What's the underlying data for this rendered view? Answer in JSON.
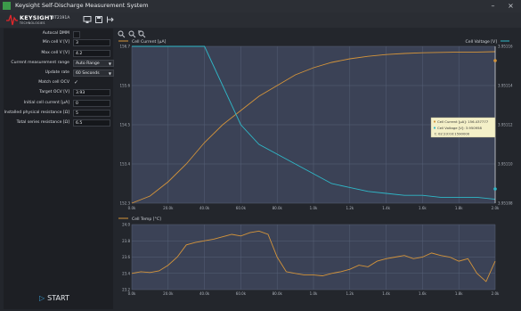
{
  "window": {
    "title": "Keysight Self-Discharge Measurement System"
  },
  "header": {
    "brand": "KEYSIGHT",
    "brand_sub": "TECHNOLOGIES",
    "model": "BT2191A"
  },
  "toolbar": {
    "icons": [
      "monitor-icon",
      "save-icon",
      "export-icon"
    ]
  },
  "settings": {
    "autocal_label": "Autocal DMM",
    "min_v_label": "Min cell V [V]",
    "min_v_value": "3",
    "max_v_label": "Max cell V [V]",
    "max_v_value": "4.2",
    "range_label": "Current measurement range",
    "range_value": "Auto Range",
    "update_label": "Update rate",
    "update_value": "60 Seconds",
    "match_label": "Match cell OCV",
    "target_label": "Target OCV [V]",
    "target_value": "3.93",
    "initial_label": "Initial cell current [µA]",
    "initial_value": "0",
    "phys_label": "Installed physical resistance [Ω]",
    "phys_value": "5",
    "series_label": "Total series resistance [Ω]",
    "series_value": "6.5"
  },
  "start_label": "START",
  "colors": {
    "current": "#d4943a",
    "voltage": "#2fb8c8",
    "temp": "#d4943a",
    "plot_bg": "#3b4256"
  },
  "tooltip": {
    "line1": "Cell Current [µA]: 156.437777",
    "line2": "Cell Voltage [V]: 3.950958",
    "line3": "t: 02:23:03:1590000"
  },
  "chart_data": [
    {
      "type": "line",
      "title": "",
      "series": [
        {
          "name": "Cell Current [µA]",
          "axis": "left",
          "x": [
            0,
            0.1,
            0.2,
            0.3,
            0.4,
            0.5,
            0.6,
            0.7,
            0.8,
            0.9,
            1.0,
            1.1,
            1.2,
            1.3,
            1.4,
            1.5,
            1.6,
            1.7,
            1.8,
            1.9,
            2.0
          ],
          "values": [
            152.3,
            152.5,
            152.9,
            153.4,
            154.0,
            154.5,
            154.9,
            155.3,
            155.6,
            155.9,
            156.1,
            156.25,
            156.35,
            156.42,
            156.47,
            156.5,
            156.52,
            156.53,
            156.54,
            156.54,
            156.55
          ]
        },
        {
          "name": "Cell Voltage [V]",
          "axis": "right",
          "x": [
            0,
            0.1,
            0.2,
            0.3,
            0.4,
            0.5,
            0.6,
            0.7,
            0.8,
            0.9,
            1.0,
            1.1,
            1.2,
            1.3,
            1.4,
            1.5,
            1.6,
            1.7,
            1.8,
            1.9,
            2.0
          ],
          "values": [
            3.9514,
            3.9513,
            3.95125,
            3.9512,
            3.95117,
            3.95114,
            3.95112,
            3.95111,
            3.951105,
            3.9511,
            3.951095,
            3.95109,
            3.951088,
            3.951086,
            3.951085,
            3.951084,
            3.951084,
            3.951083,
            3.951083,
            3.951083,
            3.951082
          ]
        }
      ],
      "xticks": [
        "0.0k",
        "20.0k",
        "40.0k",
        "60.0k",
        "80.0k",
        "1.0k",
        "1.2k",
        "1.4k",
        "1.6k",
        "1.8k",
        "2.0k"
      ],
      "yticks_left": [
        "152.3",
        "153.4",
        "154.5",
        "155.6",
        "156.7"
      ],
      "yticks_right": [
        "3.95108",
        "3.95110",
        "3.95112",
        "3.95114",
        "3.95116"
      ],
      "ylim_left": [
        152.3,
        156.7
      ],
      "ylim_right": [
        3.95108,
        3.95116
      ],
      "legend_left": "Cell Current [µA]",
      "legend_right": "Cell Voltage [V]"
    },
    {
      "type": "line",
      "title": "",
      "series": [
        {
          "name": "Cell Temp [°C]",
          "x": [
            0,
            0.05,
            0.1,
            0.15,
            0.2,
            0.25,
            0.3,
            0.35,
            0.4,
            0.45,
            0.5,
            0.55,
            0.6,
            0.65,
            0.7,
            0.75,
            0.8,
            0.85,
            0.9,
            0.95,
            1.0,
            1.05,
            1.1,
            1.15,
            1.2,
            1.25,
            1.3,
            1.35,
            1.4,
            1.45,
            1.5,
            1.55,
            1.6,
            1.65,
            1.7,
            1.75,
            1.8,
            1.85,
            1.9,
            1.95,
            2.0
          ],
          "values": [
            23.4,
            23.42,
            23.41,
            23.43,
            23.5,
            23.6,
            23.75,
            23.78,
            23.8,
            23.82,
            23.85,
            23.88,
            23.86,
            23.9,
            23.92,
            23.88,
            23.6,
            23.42,
            23.4,
            23.38,
            23.38,
            23.37,
            23.4,
            23.42,
            23.45,
            23.5,
            23.48,
            23.55,
            23.58,
            23.6,
            23.62,
            23.58,
            23.6,
            23.65,
            23.62,
            23.6,
            23.55,
            23.58,
            23.4,
            23.3,
            23.55
          ]
        }
      ],
      "yticks": [
        "23.2",
        "23.4",
        "23.6",
        "23.8",
        "24.0"
      ],
      "ylim": [
        23.2,
        24.0
      ],
      "legend": "Cell Temp [°C]"
    }
  ]
}
